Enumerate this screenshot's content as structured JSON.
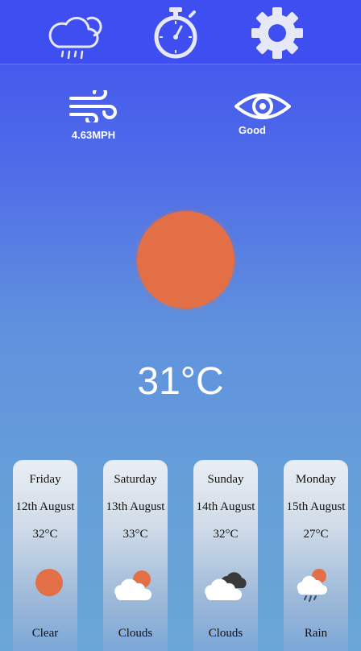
{
  "nav": {
    "items": [
      {
        "icon": "cloud-rain-icon"
      },
      {
        "icon": "stopwatch-icon"
      },
      {
        "icon": "gear-icon"
      }
    ]
  },
  "stats": {
    "wind": {
      "icon": "wind-icon",
      "value": "4.63MPH"
    },
    "visibility": {
      "icon": "eye-icon",
      "value": "Good"
    }
  },
  "current": {
    "icon": "sun-icon",
    "temperature": "31°C",
    "sun_color": "#e26f46"
  },
  "forecast": [
    {
      "day": "Friday",
      "date": "12th August",
      "temp": "32°C",
      "icon": "sun-icon",
      "condition": "Clear"
    },
    {
      "day": "Saturday",
      "date": "13th August",
      "temp": "33°C",
      "icon": "cloud-sun-icon",
      "condition": "Clouds"
    },
    {
      "day": "Sunday",
      "date": "14th August",
      "temp": "32°C",
      "icon": "clouds-icon",
      "condition": "Clouds"
    },
    {
      "day": "Monday",
      "date": "15th August",
      "temp": "27°C",
      "icon": "rain-sun-icon",
      "condition": "Rain"
    }
  ]
}
